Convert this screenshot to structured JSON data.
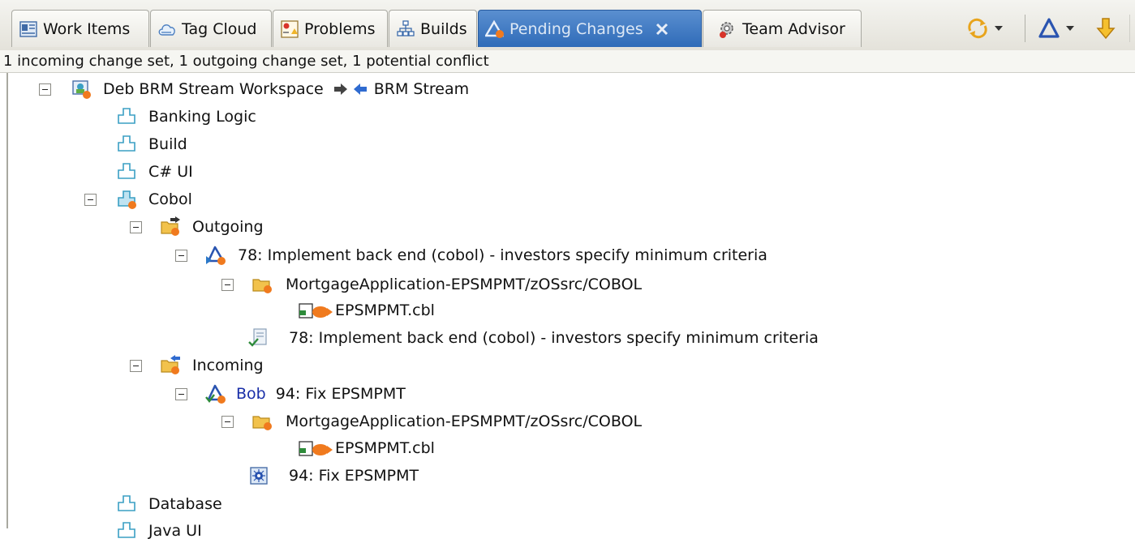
{
  "tabs": [
    {
      "label": "Work Items",
      "icon": "work-items-icon",
      "active": false
    },
    {
      "label": "Tag Cloud",
      "icon": "tag-cloud-icon",
      "active": false
    },
    {
      "label": "Problems",
      "icon": "problems-icon",
      "active": false
    },
    {
      "label": "Builds",
      "icon": "builds-icon",
      "active": false
    },
    {
      "label": "Pending Changes",
      "icon": "pending-changes-icon",
      "active": true
    },
    {
      "label": "Team Advisor",
      "icon": "team-advisor-icon",
      "active": false
    }
  ],
  "toolbar": {
    "refresh_icon": "refresh-icon",
    "delta_icon": "delta-icon",
    "accept_icon": "accept-incoming-icon"
  },
  "status_text": "1 incoming change set, 1 outgoing change set, 1 potential conflict",
  "tree": {
    "workspace": {
      "label": "Deb BRM Stream Workspace",
      "stream": "BRM Stream"
    },
    "components": {
      "banking_logic": "Banking Logic",
      "build": "Build",
      "csharp_ui": "C# UI",
      "cobol": "Cobol",
      "database": "Database",
      "java_ui": "Java UI"
    },
    "outgoing": {
      "label": "Outgoing",
      "change_set": "78: Implement back end (cobol) - investors specify minimum criteria",
      "folder": "MortgageApplication-EPSMPMT/zOSsrc/COBOL",
      "file": "EPSMPMT.cbl",
      "work_item": "78: Implement back end (cobol) - investors specify minimum criteria"
    },
    "incoming": {
      "label": "Incoming",
      "author": "Bob",
      "change_set": "94: Fix EPSMPMT",
      "folder": "MortgageApplication-EPSMPMT/zOSsrc/COBOL",
      "file": "EPSMPMT.cbl",
      "work_item": "94: Fix EPSMPMT"
    }
  },
  "colors": {
    "active_tab": "#3d76c2",
    "author_link": "#1a2fa8",
    "component_icon": "#3a9fc4",
    "folder": "#f2c24c",
    "change_arrow": "#f07a1e"
  }
}
